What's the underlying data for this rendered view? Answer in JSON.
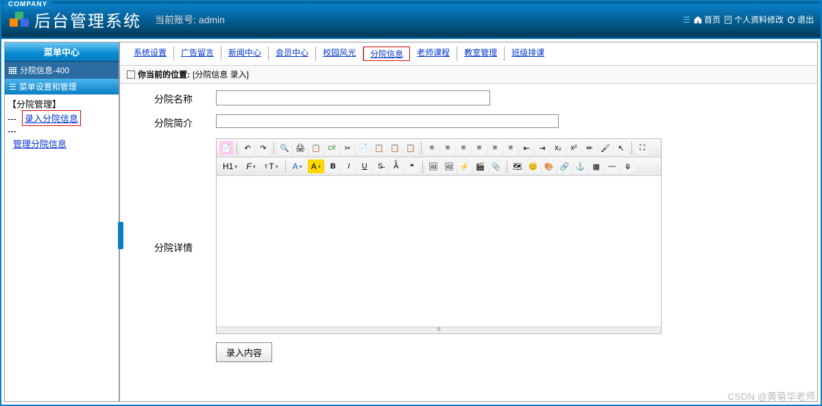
{
  "company": "COMPANY",
  "header": {
    "title": "后台管理系统",
    "account_label": "当前账号:",
    "account_value": "admin",
    "links": {
      "home": "首页",
      "profile": "个人资料修改",
      "logout": "退出"
    }
  },
  "sidebar": {
    "center": "菜单中心",
    "sub": "分院信息-400",
    "section": "菜单设置和管理",
    "group": "【分院管理】",
    "links": {
      "input": "录入分院信息",
      "manage": "管理分院信息"
    },
    "prefix": "---"
  },
  "topnav": {
    "system": "系统设置",
    "ad": "广告留言",
    "news": "新闻中心",
    "member": "会员中心",
    "campus": "校园风光",
    "branch": "分院信息",
    "teacher": "老师课程",
    "classroom": "教室管理",
    "schedule": "班级排课"
  },
  "breadcrumb": {
    "label": "你当前的位置:",
    "path": "[分院信息 录入]"
  },
  "form": {
    "name_label": "分院名称",
    "intro_label": "分院简介",
    "detail_label": "分院详情",
    "submit": "录入内容",
    "editor": {
      "h1": "H1",
      "font_family": "F",
      "font_size": "T",
      "a_color": "A",
      "a_bg": "A",
      "bold": "B",
      "italic": "I",
      "underline": "U",
      "handle": "≡"
    }
  },
  "watermark": "CSDN @黄菊华老师"
}
